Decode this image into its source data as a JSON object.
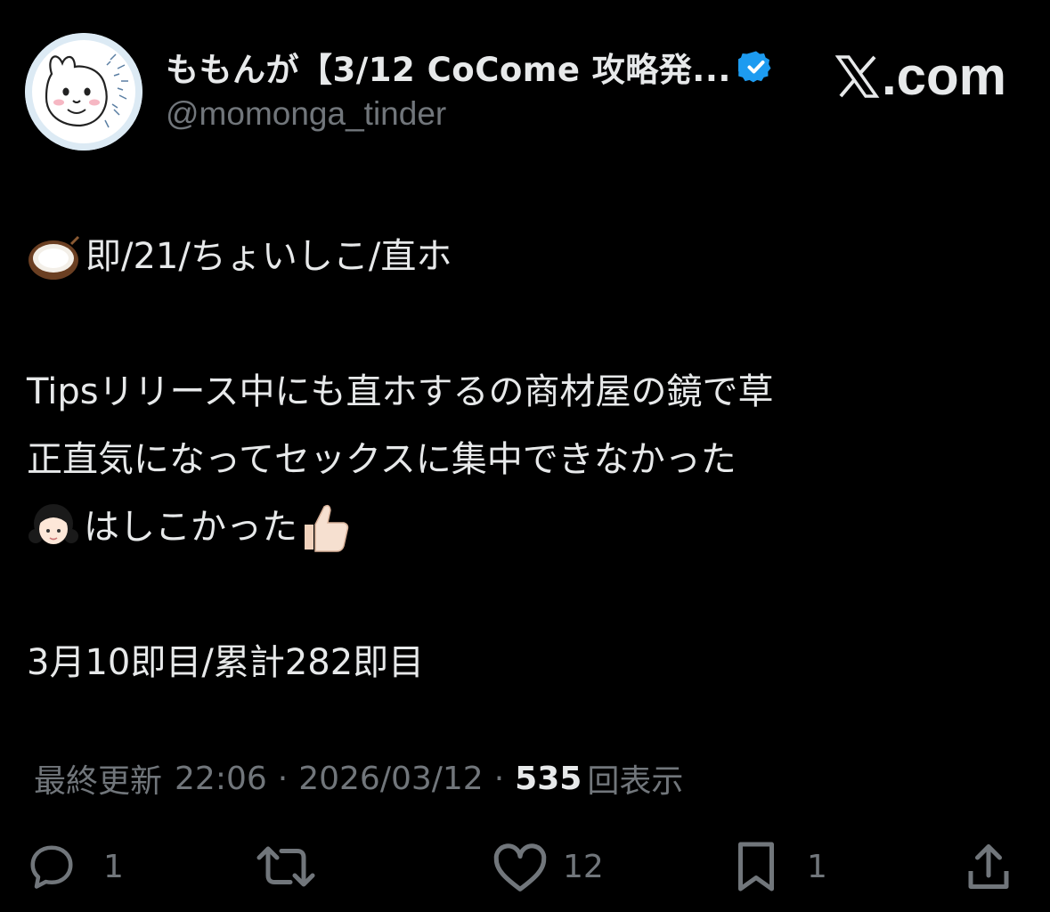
{
  "header": {
    "display_name": "ももんが【3/12 CoCome 攻略発...",
    "handle": "@momonga_tinder",
    "site": ".com",
    "verified_color": "#1d9bf0"
  },
  "tweet": {
    "line1": "即/21/ちょいしこ/直ホ",
    "line2": "Tipsリリース中にも直ホするの商材屋の鏡で草",
    "line3": "正直気になってセックスに集中できなかった",
    "line4": "はしこかった",
    "line5": "3月10即目/累計282即目"
  },
  "meta": {
    "label": "最終更新",
    "time": "22:06",
    "date": "2026/03/12",
    "views_count": "535",
    "views_label": "回表示"
  },
  "actions": {
    "reply_count": "1",
    "like_count": "12",
    "bookmark_count": "1"
  },
  "icons": {
    "avatar": "momonga-avatar-icon",
    "verified": "verified-badge-icon",
    "reply": "reply-icon",
    "retweet": "retweet-icon",
    "like": "heart-icon",
    "bookmark": "bookmark-icon",
    "share": "share-icon"
  },
  "colors": {
    "background": "#000000",
    "text": "#e7e9ea",
    "secondary": "#71767b"
  }
}
